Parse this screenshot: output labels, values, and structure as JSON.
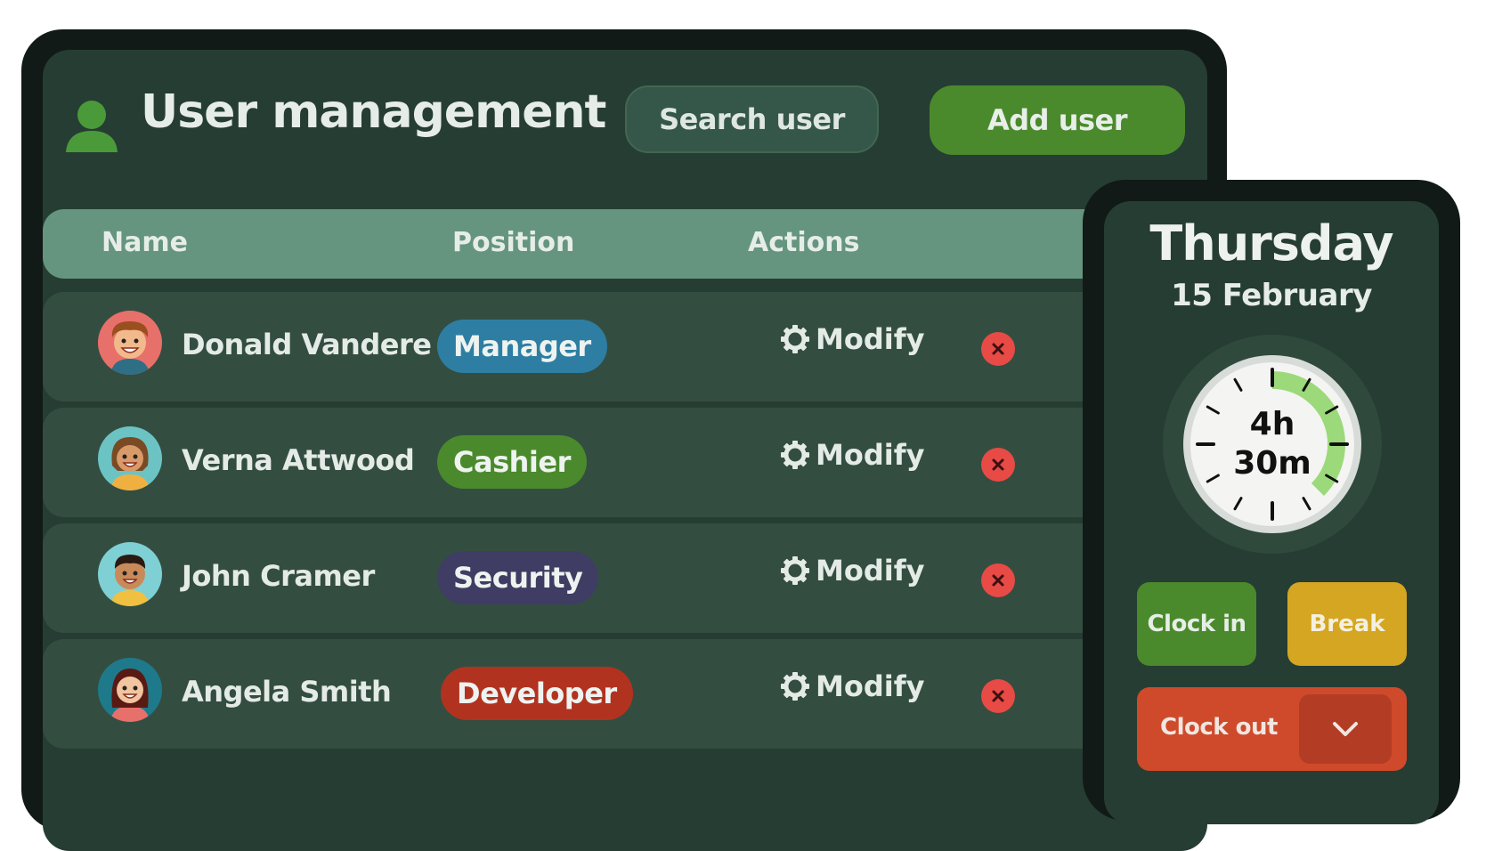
{
  "header": {
    "title": "User management",
    "search_label": "Search user",
    "add_label": "Add user"
  },
  "table": {
    "columns": [
      "Name",
      "Position",
      "Actions"
    ],
    "rows": [
      {
        "name": "Donald Vandere",
        "position": "Manager",
        "position_color": "#2e7ea3",
        "action": "Modify"
      },
      {
        "name": "Verna Attwood",
        "position": "Cashier",
        "position_color": "#4a8a2c",
        "action": "Modify"
      },
      {
        "name": "John Cramer",
        "position": "Security",
        "position_color": "#3f3d63",
        "action": "Modify"
      },
      {
        "name": "Angela Smith",
        "position": "Developer",
        "position_color": "#b23220",
        "action": "Modify"
      }
    ]
  },
  "time_widget": {
    "day": "Thursday",
    "date": "15 February",
    "elapsed_hours": "4h",
    "elapsed_minutes": "30m",
    "elapsed_fraction": 0.375,
    "clock_in_label": "Clock in",
    "break_label": "Break",
    "clock_out_label": "Clock out"
  },
  "icons": {
    "user": "user-icon",
    "modify": "gear-icon",
    "delete": "close-icon",
    "expand": "chevron-down-icon"
  },
  "colors": {
    "accent_green": "#4a8a2c",
    "break_yellow": "#d4a621",
    "clock_out_red": "#cf4a2b",
    "delete_red": "#e84a45",
    "progress_green": "#9cd97a"
  }
}
